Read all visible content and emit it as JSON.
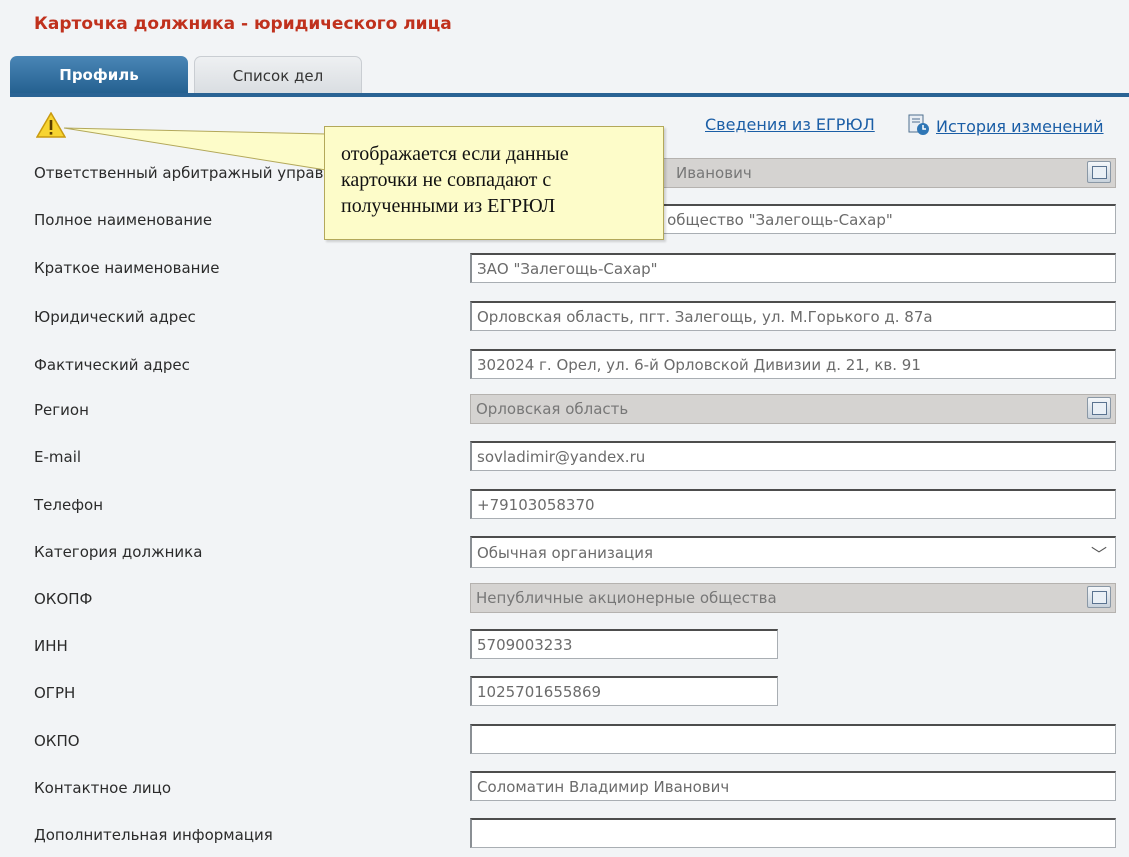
{
  "page_title": "Карточка должника - юридического лица",
  "tabs": [
    {
      "label": "Профиль"
    },
    {
      "label": "Список дел"
    }
  ],
  "links": {
    "egrul": "Сведения из ЕГРЮЛ",
    "history": "История изменений"
  },
  "tooltip": "отображается если данные карточки не совпадают с полученными из ЕГРЮЛ",
  "fields": [
    {
      "label": "Ответственный арбитражный управляющий",
      "value": "Иванович"
    },
    {
      "label": "Полное наименование",
      "value": "Закрытое акционерное общество \"Залегощь-Сахар\""
    },
    {
      "label": "Краткое наименование",
      "value": "ЗАО \"Залегощь-Сахар\""
    },
    {
      "label": "Юридический адрес",
      "value": "Орловская область, пгт. Залегощь, ул. М.Горького д. 87а"
    },
    {
      "label": "Фактический адрес",
      "value": "302024 г. Орел, ул. 6-й Орловской Дивизии д. 21, кв. 91"
    },
    {
      "label": "Регион",
      "value": "Орловская область"
    },
    {
      "label": "E-mail",
      "value": "sovladimir@yandex.ru"
    },
    {
      "label": "Телефон",
      "value": "+79103058370"
    },
    {
      "label": "Категория должника",
      "value": "Обычная организация"
    },
    {
      "label": "ОКОПФ",
      "value": "Непубличные акционерные общества"
    },
    {
      "label": "ИНН",
      "value": "5709003233"
    },
    {
      "label": "ОГРН",
      "value": "1025701655869"
    },
    {
      "label": "ОКПО",
      "value": ""
    },
    {
      "label": "Контактное лицо",
      "value": "Соломатин Владимир Иванович"
    },
    {
      "label": "Дополнительная информация",
      "value": ""
    }
  ]
}
